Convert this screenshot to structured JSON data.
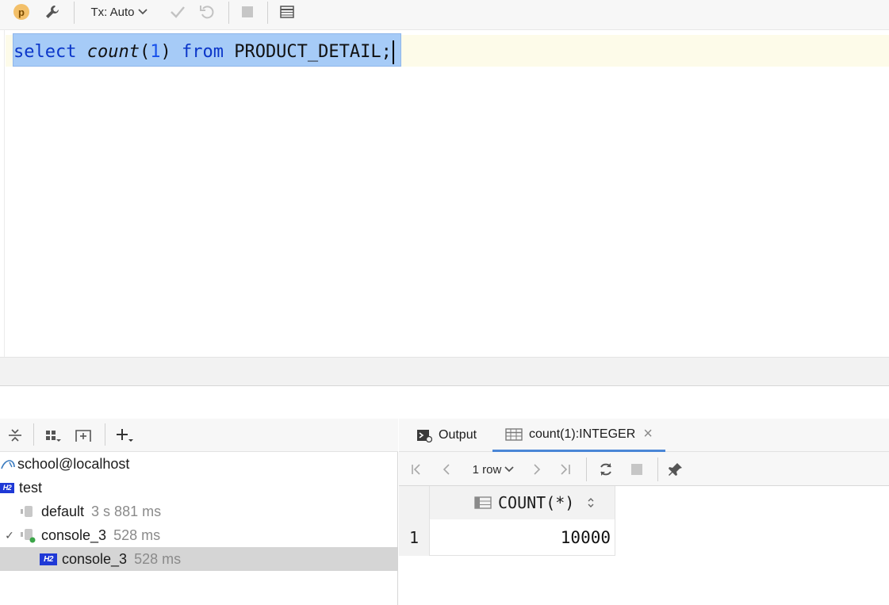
{
  "toolbar": {
    "profile_badge": "p",
    "tx_mode_label": "Tx: Auto",
    "icons": [
      "wrench-icon",
      "chevron-down-icon",
      "check-icon",
      "undo-icon",
      "stop-icon",
      "table-icon"
    ]
  },
  "editor": {
    "sql": {
      "keyword_select": "select",
      "function_name": "count",
      "open_paren": "(",
      "argument": "1",
      "close_paren": ")",
      "keyword_from": "from",
      "table_name": "PRODUCT_DETAIL",
      "terminator": ";"
    },
    "colors": {
      "keyword": "#0b36c9",
      "selection": "#a6cbf7",
      "number": "#1750eb"
    }
  },
  "services_tree": {
    "toolbar_icons": [
      "collapse-icon",
      "group-icon",
      "add-frame-icon",
      "add-icon"
    ],
    "items": [
      {
        "label": "school@localhost",
        "meta": "",
        "icon": "mysql-icon"
      },
      {
        "label": "test",
        "meta": "",
        "icon": "h2-icon",
        "badge": "H2"
      },
      {
        "label": "default",
        "meta": "3 s 881 ms",
        "icon": "session-icon"
      },
      {
        "label": "console_3",
        "meta": "528 ms",
        "icon": "session-active-icon",
        "expand": "✓"
      },
      {
        "label": "console_3",
        "meta": "528 ms",
        "icon": "h2-icon",
        "badge": "H2",
        "selected": true
      }
    ]
  },
  "results": {
    "tabs": [
      {
        "label": "Output",
        "icon": "console-icon"
      },
      {
        "label": "count(1):INTEGER",
        "icon": "grid-icon",
        "active": true,
        "close": "×"
      }
    ],
    "toolbar": {
      "row_count_label": "1 row",
      "icons": [
        "first-page-icon",
        "prev-page-icon",
        "next-page-icon",
        "last-page-icon",
        "refresh-icon",
        "stop-icon",
        "pin-icon"
      ]
    },
    "grid": {
      "columns": [
        {
          "label": "COUNT(*)",
          "sort_icon": "sort-icon"
        }
      ],
      "rows": [
        {
          "row_number": "1",
          "cells": [
            "10000"
          ]
        }
      ]
    }
  }
}
